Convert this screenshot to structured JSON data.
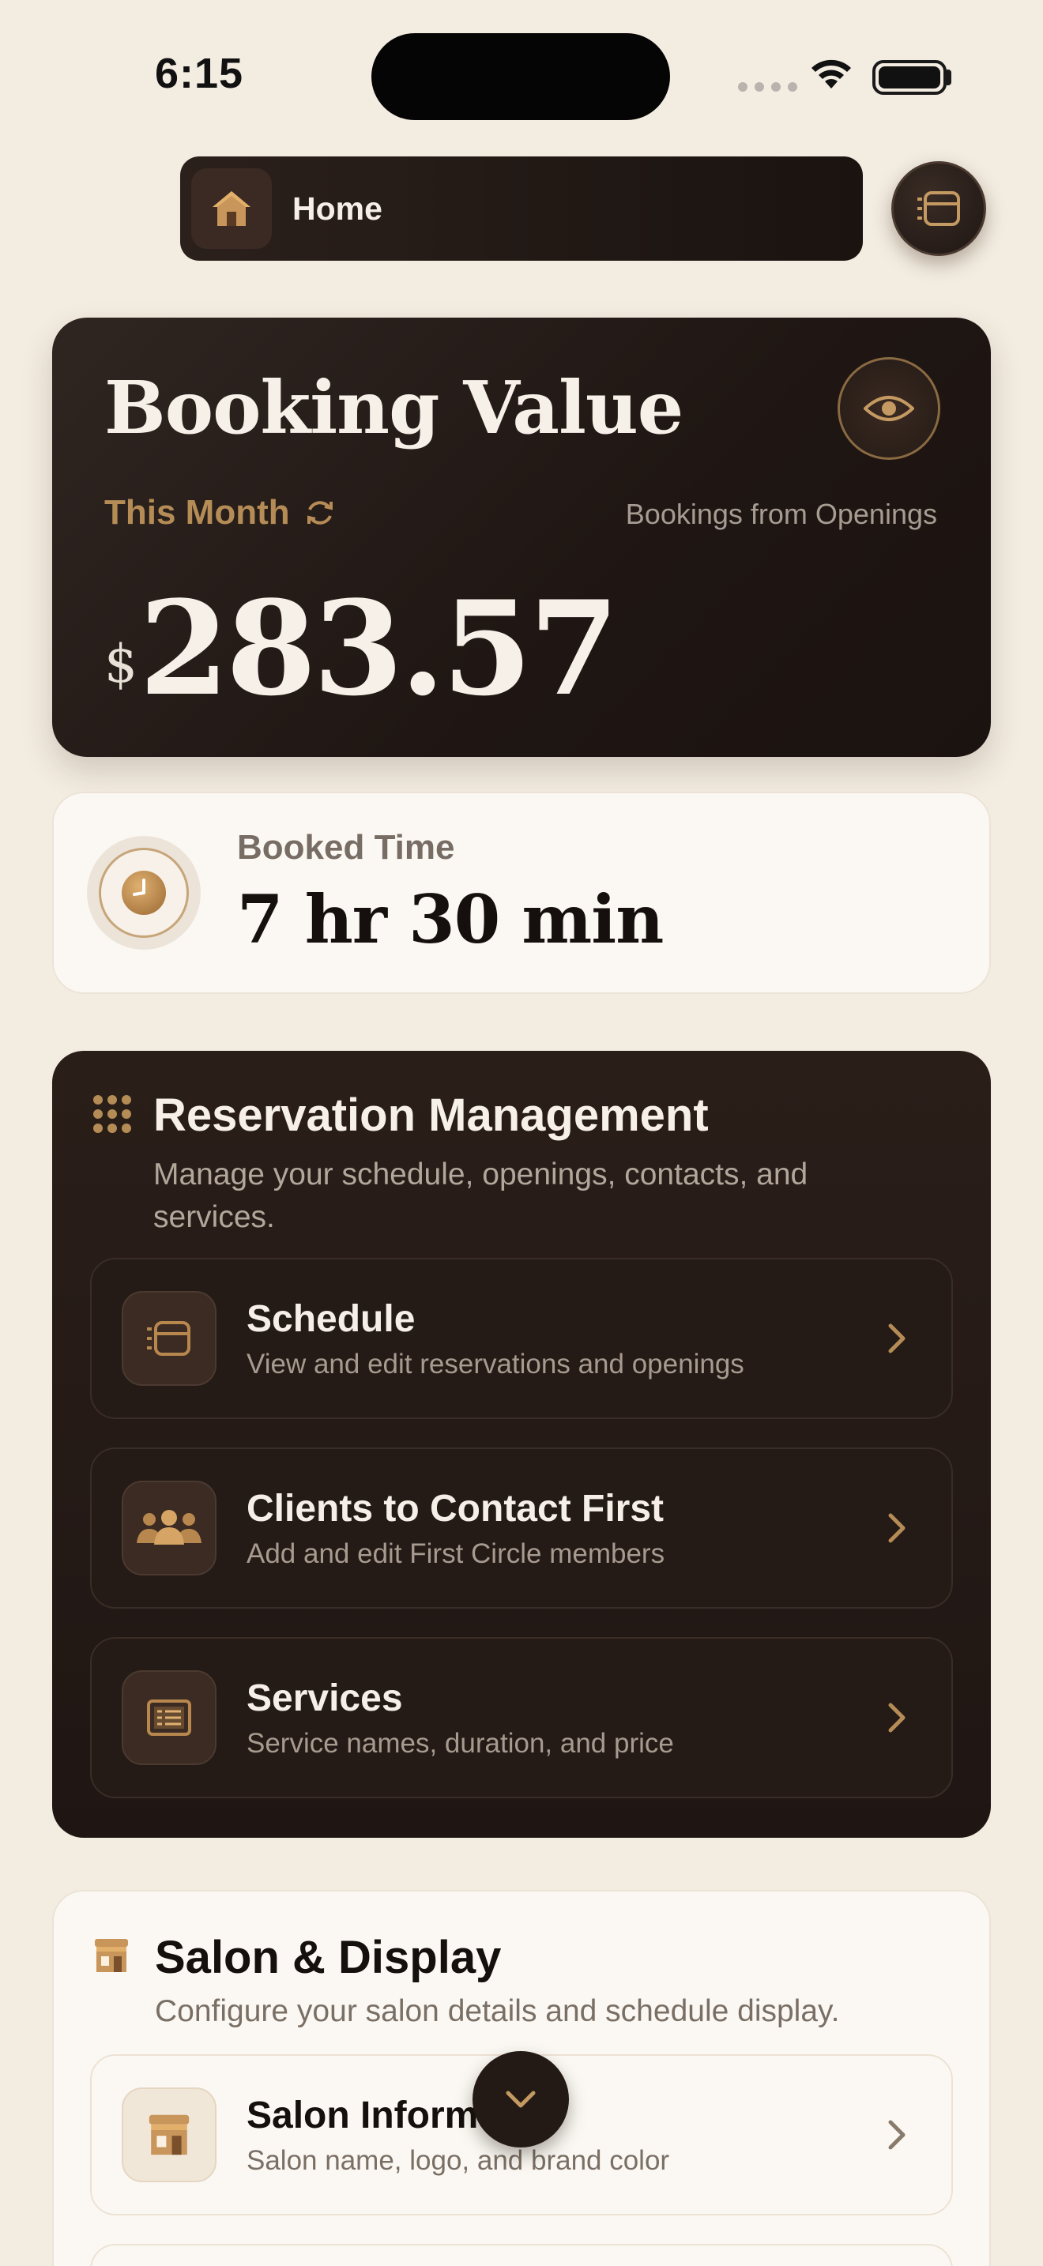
{
  "status_bar": {
    "time": "6:15"
  },
  "nav": {
    "home_label": "Home"
  },
  "booking_value": {
    "title": "Booking Value",
    "period": "This Month",
    "source": "Bookings from Openings",
    "currency": "$",
    "amount": "283.57"
  },
  "booked_time": {
    "label": "Booked Time",
    "value": "7 hr 30 min"
  },
  "reservation": {
    "title": "Reservation Management",
    "description": "Manage your schedule, openings, contacts, and services.",
    "items": [
      {
        "title": "Schedule",
        "subtitle": "View and edit reservations and openings",
        "icon": "schedule-icon"
      },
      {
        "title": "Clients to Contact First",
        "subtitle": "Add and edit First Circle members",
        "icon": "people-icon"
      },
      {
        "title": "Services",
        "subtitle": "Service names, duration, and price",
        "icon": "service-list-icon"
      }
    ]
  },
  "salon_display": {
    "title": "Salon & Display",
    "description": "Configure your salon details and schedule display.",
    "items": [
      {
        "title": "Salon Informa",
        "subtitle": "Salon name, logo, and brand color",
        "icon": "storefront-icon"
      }
    ]
  },
  "colors": {
    "accent": "#b58c56",
    "dark_card": "#1f1613",
    "background": "#f3ece1"
  }
}
